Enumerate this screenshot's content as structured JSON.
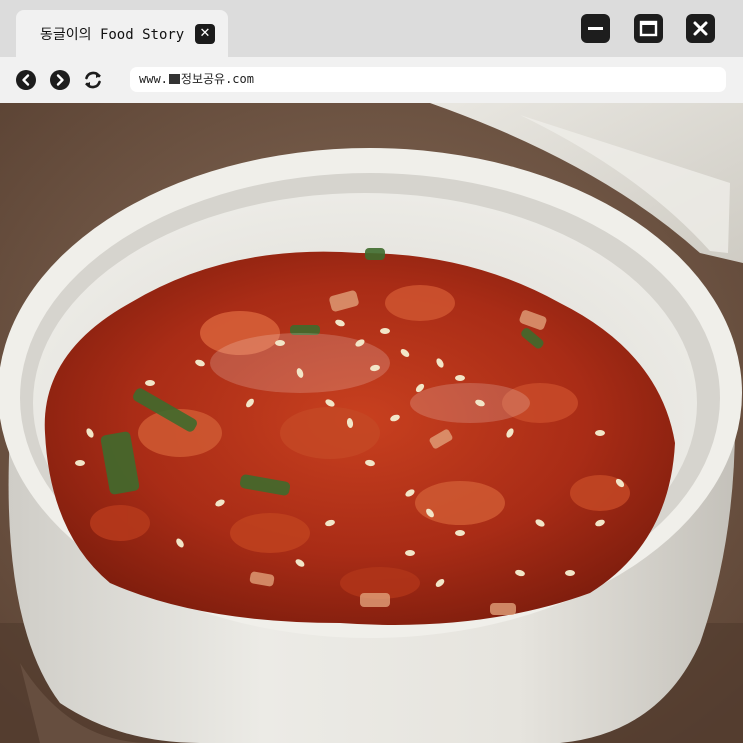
{
  "tab": {
    "title": "동글이의 Food Story",
    "close_icon": "close-icon"
  },
  "window_controls": [
    "minimize-icon",
    "maximize-icon",
    "close-icon"
  ],
  "navigation": [
    "back-icon",
    "forward-icon",
    "refresh-icon"
  ],
  "address": {
    "prefix": "www.",
    "suffix": "정보공유.com"
  },
  "colors": {
    "titlebar": "#dcdcdc",
    "tab": "#f1f1f1",
    "control": "#1d1d1d",
    "sauce": "#b5321c",
    "bowl": "#ecebe6"
  }
}
